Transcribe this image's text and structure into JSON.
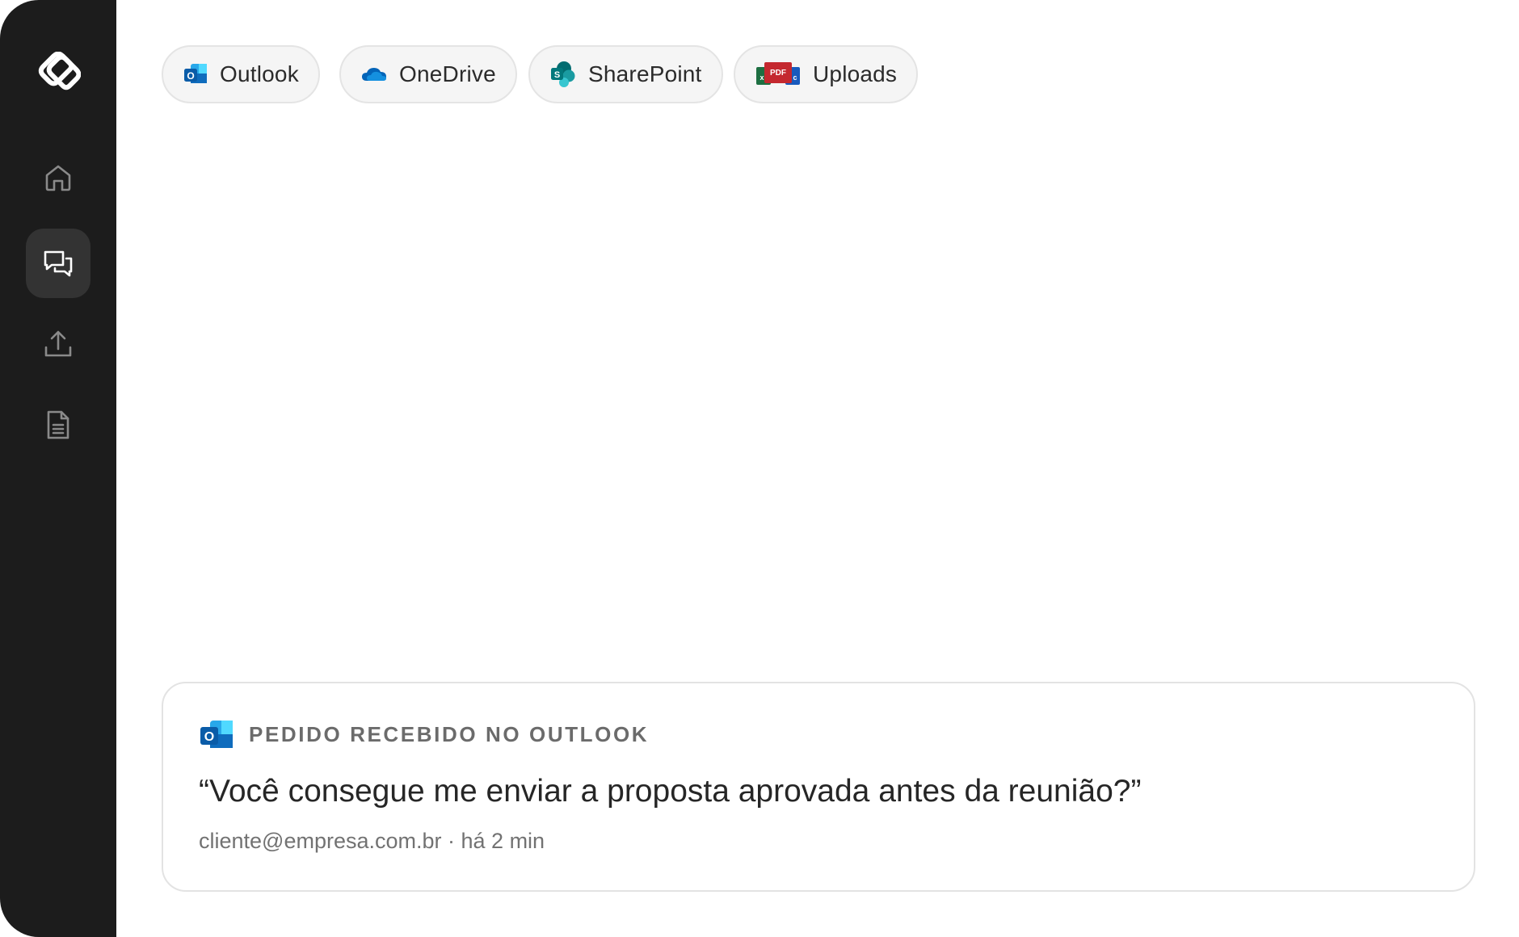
{
  "sidebar": {
    "logo_icon": "knot-logo-icon",
    "items": [
      {
        "name": "home",
        "icon": "home-icon",
        "active": false
      },
      {
        "name": "chat",
        "icon": "chat-icon",
        "active": true
      },
      {
        "name": "upload",
        "icon": "upload-icon",
        "active": false
      },
      {
        "name": "documents",
        "icon": "document-icon",
        "active": false
      }
    ]
  },
  "sources": [
    {
      "label": "Outlook",
      "icon": "outlook-icon"
    },
    {
      "label": "OneDrive",
      "icon": "onedrive-icon"
    },
    {
      "label": "SharePoint",
      "icon": "sharepoint-icon"
    },
    {
      "label": "Uploads",
      "icon": "uploads-files-icon"
    }
  ],
  "notification": {
    "title": "PEDIDO RECEBIDO NO OUTLOOK",
    "quote": "“Você consegue me enviar a proposta aprovada antes da reunião?”",
    "meta": "cliente@empresa.com.br · há 2 min",
    "icon": "outlook-icon"
  },
  "colors": {
    "sidebar_bg": "#1c1c1c",
    "active_item_bg": "#333333",
    "outlook_blue": "#0f6cbd",
    "onedrive_blue": "#0364b8",
    "sharepoint_teal": "#03787c",
    "pdf_red": "#c4282f"
  }
}
